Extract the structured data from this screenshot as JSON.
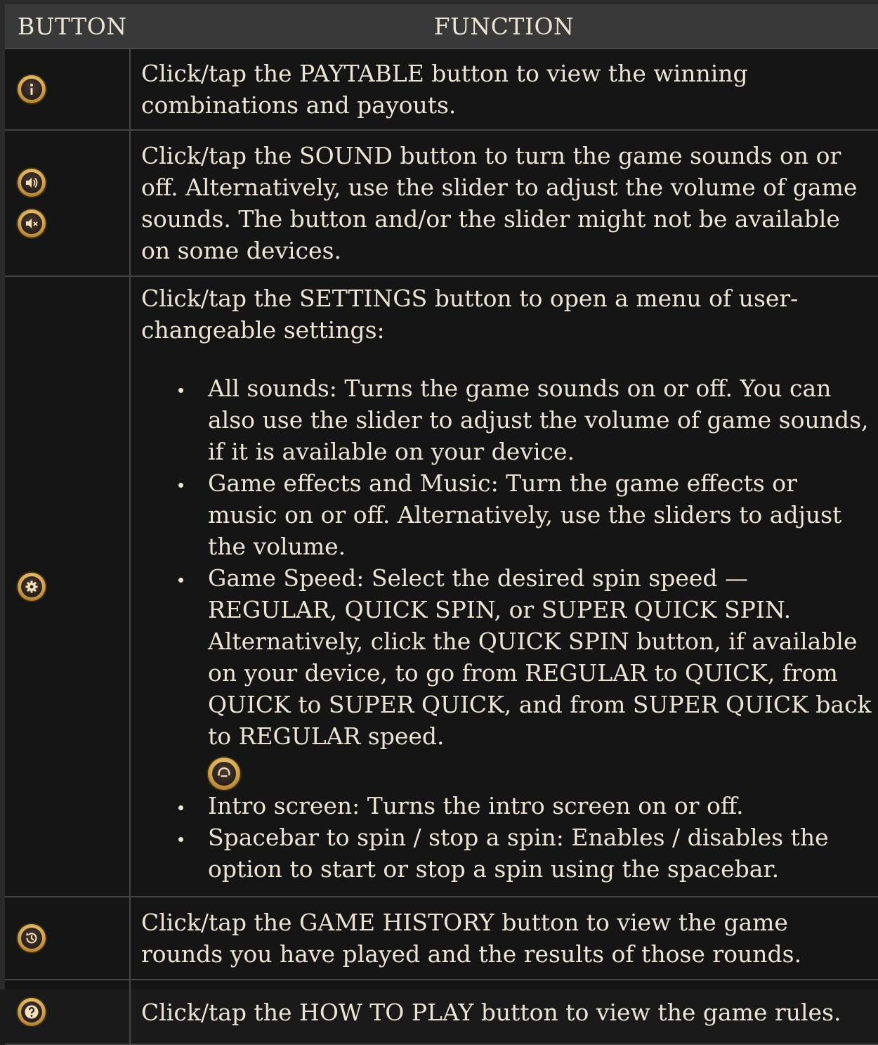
{
  "header": {
    "button_col": "BUTTON",
    "function_col": "FUNCTION"
  },
  "rows": [
    {
      "icons": [
        "info-icon"
      ],
      "text": "Click/tap the PAYTABLE button to view the winning combinations and payouts."
    },
    {
      "icons": [
        "sound-on-icon",
        "sound-off-icon"
      ],
      "text": "Click/tap the SOUND button to turn the game sounds on or off. Alternatively, use the slider to adjust the volume of game sounds. The button and/or the slider might not be available on some devices."
    },
    {
      "icons": [
        "settings-icon"
      ],
      "intro": "Click/tap the SETTINGS button to open a menu of user-changeable settings:",
      "bullets": [
        "All sounds: Turns the game sounds on or off. You can also use the slider to adjust the volume of game sounds, if it is available on your device.",
        "Game effects and Music: Turn the game effects or music on or off. Alternatively, use the sliders to adjust the volume.",
        "Game Speed: Select the desired spin speed — REGULAR, QUICK SPIN, or SUPER QUICK SPIN. Alternatively, click the QUICK SPIN button, if available on your device, to go from REGULAR to QUICK, from QUICK to SUPER QUICK, and from SUPER QUICK back to REGULAR speed.",
        "Intro screen: Turns the intro screen on or off.",
        "Spacebar to spin / stop a spin: Enables / disables the option to start or stop a spin using the spacebar."
      ],
      "inline_icon": "quick-spin-icon"
    },
    {
      "icons": [
        "history-icon"
      ],
      "text": "Click/tap the GAME HISTORY button to view the game rounds you have played and the results of those rounds."
    },
    {
      "icons": [
        "help-icon"
      ],
      "text": "Click/tap the HOW TO PLAY button to view the game rules."
    }
  ],
  "colors": {
    "background": "#151515",
    "header_bg": "#393939",
    "text": "#ece4d4",
    "gold": "#d2a24a"
  }
}
